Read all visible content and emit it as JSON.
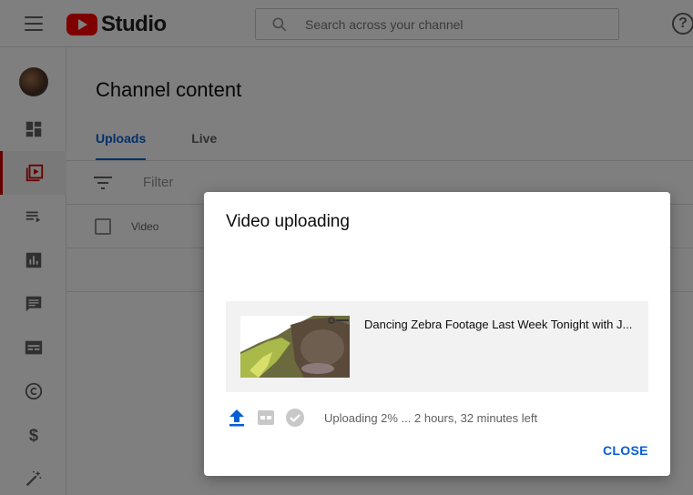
{
  "header": {
    "logo_text": "Studio",
    "search_placeholder": "Search across your channel",
    "help_label": "?"
  },
  "sidebar": {
    "items": [
      {
        "name": "dashboard",
        "icon": "dashboard-icon"
      },
      {
        "name": "content",
        "icon": "content-icon",
        "active": true
      },
      {
        "name": "playlists",
        "icon": "playlists-icon"
      },
      {
        "name": "analytics",
        "icon": "analytics-icon"
      },
      {
        "name": "comments",
        "icon": "comments-icon"
      },
      {
        "name": "subtitles",
        "icon": "subtitles-icon"
      },
      {
        "name": "copyright",
        "icon": "copyright-icon"
      },
      {
        "name": "monetization",
        "icon": "dollar-icon"
      },
      {
        "name": "customization",
        "icon": "magic-wand-icon"
      }
    ]
  },
  "main": {
    "title": "Channel content",
    "tabs": [
      {
        "label": "Uploads",
        "active": true
      },
      {
        "label": "Live",
        "active": false
      }
    ],
    "filter_placeholder": "Filter",
    "column_video": "Video"
  },
  "dialog": {
    "title": "Video uploading",
    "video_title": "Dancing Zebra Footage Last Week Tonight with J...",
    "status_text": "Uploading 2% ... 2 hours, 32 minutes left",
    "upload_progress_percent": 2,
    "close_label": "CLOSE"
  },
  "colors": {
    "accent": "#065fd4",
    "brand_red": "#ff0000",
    "active_border": "#cc0000"
  }
}
